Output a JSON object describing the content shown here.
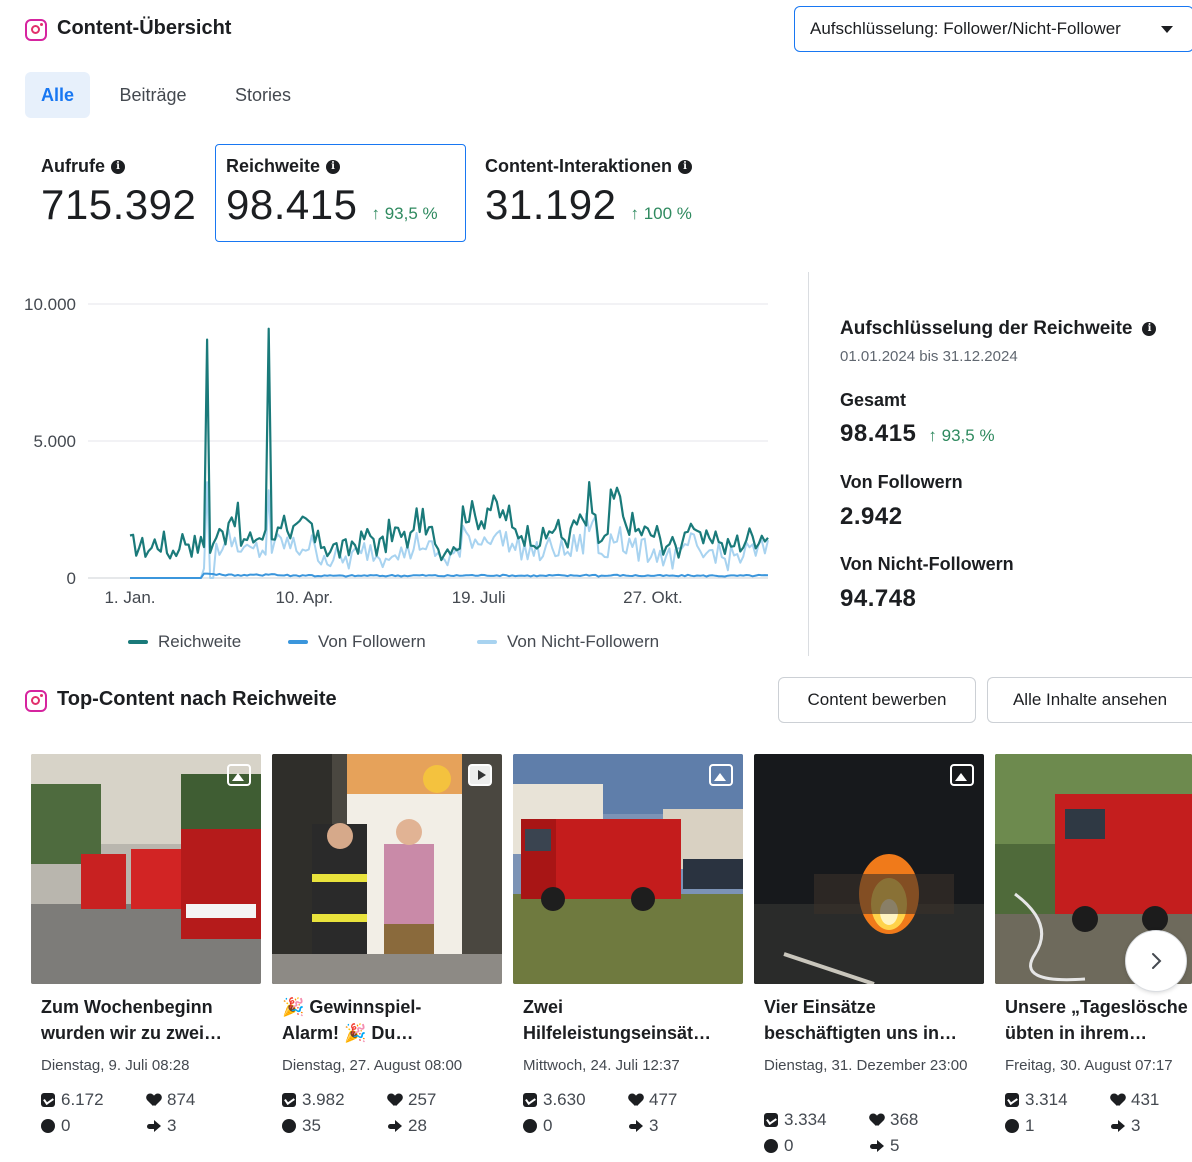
{
  "header": {
    "title": "Content-Übersicht",
    "breakdown_dropdown": "Aufschlüsselung: Follower/Nicht-Follower"
  },
  "tabs": [
    {
      "label": "Alle",
      "active": true
    },
    {
      "label": "Beiträge",
      "active": false
    },
    {
      "label": "Stories",
      "active": false
    }
  ],
  "metrics": {
    "views": {
      "label": "Aufrufe",
      "value": "715.392"
    },
    "reach": {
      "label": "Reichweite",
      "value": "98.415",
      "delta": "↑ 93,5 %",
      "selected": true
    },
    "interactions": {
      "label": "Content-Interaktionen",
      "value": "31.192",
      "delta": "↑ 100 %"
    }
  },
  "chart_data": {
    "type": "line",
    "x_ticks": [
      "1. Jan.",
      "10. Apr.",
      "19. Juli",
      "27. Okt."
    ],
    "y_ticks": [
      "0",
      "5.000",
      "10.000"
    ],
    "ylim": [
      0,
      10000
    ],
    "x_range": [
      "2024-01-01",
      "2024-12-31"
    ],
    "grid": true,
    "legend_position": "bottom",
    "colors": {
      "Reichweite": "#1a7a7a",
      "Von Followern": "#3b96dc",
      "Von Nicht-Followern": "#a8d3f0"
    },
    "series": [
      {
        "name": "Reichweite",
        "values_weekly": [
          1200,
          1100,
          1300,
          1000,
          1400,
          1200,
          8700,
          1600,
          2300,
          1300,
          1500,
          9100,
          2100,
          1700,
          1900,
          1300,
          1100,
          1000,
          1300,
          1500,
          1200,
          1700,
          1400,
          2100,
          1600,
          1100,
          1300,
          2400,
          2200,
          2600,
          2300,
          1700,
          1600,
          1400,
          1800,
          1500,
          2000,
          3500,
          1400,
          2900,
          2000,
          1700,
          1600,
          1300,
          1100,
          2000,
          1300,
          1600,
          1100,
          1300,
          1500,
          1600
        ]
      },
      {
        "name": "Von Followern",
        "values_weekly": [
          0,
          0,
          0,
          0,
          0,
          0,
          150,
          120,
          110,
          100,
          110,
          140,
          100,
          90,
          100,
          80,
          80,
          75,
          80,
          90,
          80,
          90,
          85,
          95,
          90,
          80,
          85,
          100,
          95,
          100,
          95,
          90,
          85,
          80,
          90,
          85,
          95,
          110,
          80,
          100,
          90,
          85,
          85,
          80,
          75,
          90,
          80,
          85,
          75,
          80,
          85,
          90
        ]
      },
      {
        "name": "Von Nicht-Followern",
        "values_weekly": [
          0,
          0,
          0,
          0,
          0,
          0,
          3500,
          1200,
          1400,
          900,
          1000,
          3200,
          1300,
          1100,
          1200,
          900,
          700,
          650,
          800,
          1000,
          800,
          1100,
          900,
          1300,
          1000,
          700,
          850,
          1500,
          1400,
          1600,
          1400,
          1100,
          1000,
          900,
          1100,
          950,
          1200,
          2000,
          900,
          1700,
          1200,
          1000,
          1000,
          800,
          700,
          1200,
          800,
          1000,
          700,
          800,
          950,
          1000
        ]
      }
    ]
  },
  "breakdown": {
    "title": "Aufschlüsselung der Reichweite",
    "date_range": "01.01.2024 bis 31.12.2024",
    "total_label": "Gesamt",
    "total_value": "98.415",
    "total_delta": "↑ 93,5 %",
    "followers_label": "Von Followern",
    "followers_value": "2.942",
    "nonfollowers_label": "Von Nicht-Followern",
    "nonfollowers_value": "94.748"
  },
  "top_content": {
    "title": "Top-Content nach Reichweite",
    "promote_button": "Content bewerben",
    "view_all_button": "Alle Inhalte ansehen",
    "cards": [
      {
        "title": "Zum Wochenbeginn\nwurden wir zu zwei…",
        "date": "Dienstag, 9. Juli 08:28",
        "reach": "6.172",
        "likes": "874",
        "comments": "0",
        "shares": "3",
        "media": "photo"
      },
      {
        "title": "🎉 Gewinnspiel-\nAlarm! 🎉 Du…",
        "date": "Dienstag, 27. August 08:00",
        "reach": "3.982",
        "likes": "257",
        "comments": "35",
        "shares": "28",
        "media": "video"
      },
      {
        "title": "Zwei\nHilfeleistungseinsät…",
        "date": "Mittwoch, 24. Juli 12:37",
        "reach": "3.630",
        "likes": "477",
        "comments": "0",
        "shares": "3",
        "media": "photo"
      },
      {
        "title": "Vier Einsätze\nbeschäftigten uns in…",
        "date": "Dienstag, 31. Dezember 23:00",
        "reach": "3.334",
        "likes": "368",
        "comments": "0",
        "shares": "5",
        "media": "photo"
      },
      {
        "title": "Unsere „Tageslösche\nübten in ihrem…",
        "date": "Freitag, 30. August 07:17",
        "reach": "3.314",
        "likes": "431",
        "comments": "1",
        "shares": "3",
        "media": "photo"
      }
    ]
  },
  "icons": {
    "instagram": "instagram-icon",
    "info": "info-icon",
    "next": "chevron-right-icon"
  }
}
